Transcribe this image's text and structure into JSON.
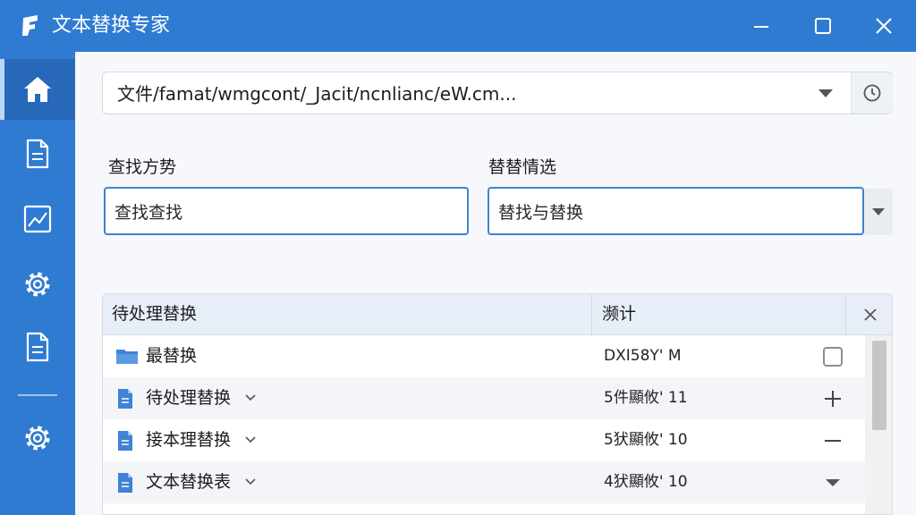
{
  "window": {
    "title": "文本替换专家",
    "logo_icon": "app-logo-icon",
    "minimize_icon": "minimize-icon",
    "maximize_icon": "maximize-icon",
    "close_icon": "close-icon"
  },
  "sidebar": {
    "items": [
      {
        "icon": "home-icon",
        "active": true
      },
      {
        "icon": "document-icon",
        "active": false
      },
      {
        "icon": "chart-icon",
        "active": false
      },
      {
        "icon": "gear-icon",
        "active": false
      },
      {
        "icon": "document-list-icon",
        "active": false
      }
    ],
    "bottom_icon": "gear-icon"
  },
  "path": {
    "value": "文件/famat/wmgcont/_Jacit/ncnlianc/eW.cm...",
    "dropdown_icon": "chevron-down-icon",
    "history_icon": "history-icon"
  },
  "find": {
    "label": "查找方势",
    "value": "查找查找"
  },
  "replace": {
    "label": "替替情选",
    "value": "替找与替换",
    "dropdown_icon": "chevron-down-icon"
  },
  "table": {
    "col_name": "待处理替换",
    "col_status": "濒计",
    "close_icon": "close-icon",
    "rows": [
      {
        "name": "最替换",
        "status": "DXI58Y' M",
        "icon": "folder-icon",
        "expandable": false,
        "action": "checkbox"
      },
      {
        "name": "待处理替换",
        "status": "5件顯攸' 11",
        "icon": "document-icon",
        "expandable": true,
        "action": "plus"
      },
      {
        "name": "接本理替换",
        "status": "5犾顯攸' 10",
        "icon": "document-icon",
        "expandable": true,
        "action": "minus"
      },
      {
        "name": "文本替换表",
        "status": "4犾顯攸' 10",
        "icon": "document-icon",
        "expandable": true,
        "action": "dropdown"
      }
    ]
  },
  "colors": {
    "accent": "#2f7bd2",
    "input_border": "#3f82d6",
    "header_bg": "#e7eef8"
  }
}
